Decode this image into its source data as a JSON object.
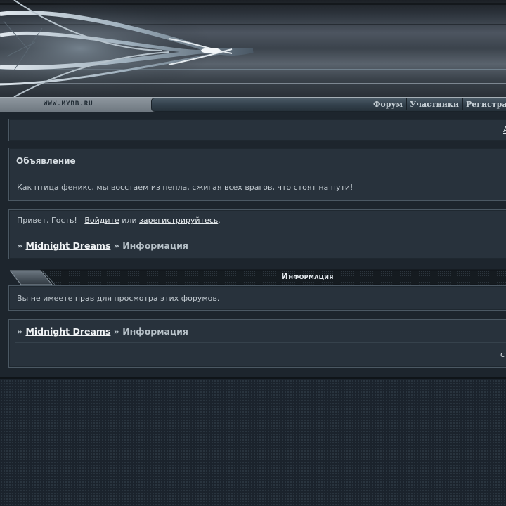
{
  "header": {
    "site_url": "WWW.MYBB.RU",
    "nav": [
      {
        "label": "Форум"
      },
      {
        "label": "Участники"
      },
      {
        "label": "Регистра"
      }
    ]
  },
  "top_panel": {
    "link": "А"
  },
  "announcement": {
    "title": "Объявление",
    "text": "Как птица феникс, мы восстаем из пепла, сжигая всех врагов, что стоят на пути!"
  },
  "greeting": {
    "prefix": "Привет, Гость!",
    "login": "Войдите",
    "or": "или",
    "register": "зарегистрируйтесь",
    "suffix": "."
  },
  "breadcrumb": {
    "sep": "»",
    "forum": "Midnight Dreams",
    "page": "Информация"
  },
  "info": {
    "title": "Информация",
    "message": "Вы не имеете прав для просмотра этих форумов."
  },
  "bottom_panel": {
    "link": "с"
  }
}
